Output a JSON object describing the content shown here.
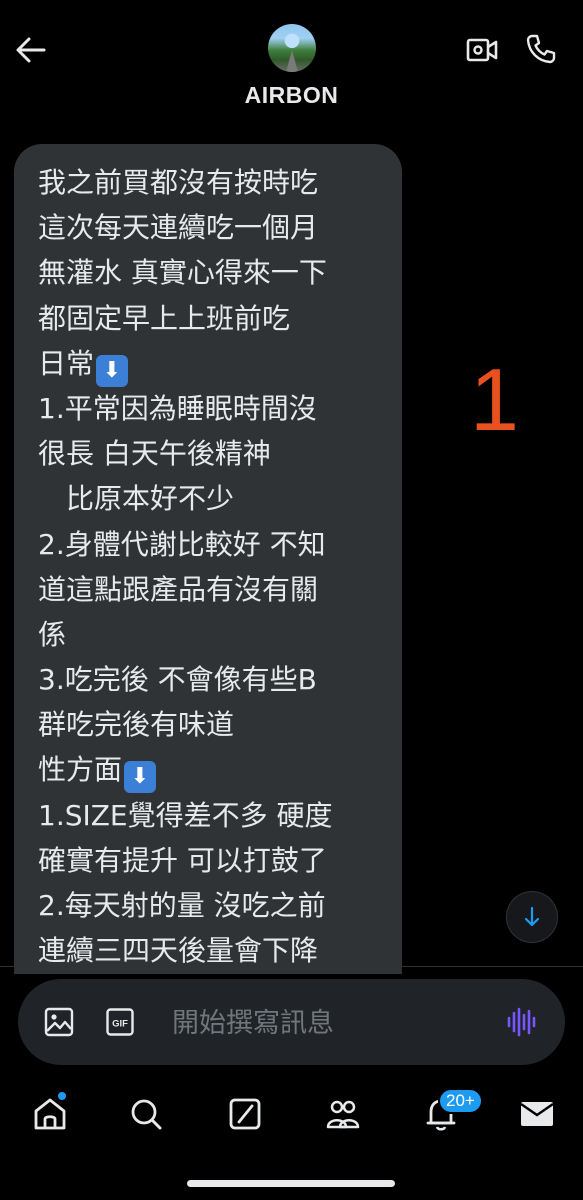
{
  "header": {
    "contact_name": "AIRBON",
    "back_icon": "arrow-left-icon",
    "video_icon": "video-camera-icon",
    "phone_icon": "phone-icon"
  },
  "message": {
    "lines": [
      "我之前買都沒有按時吃",
      "這次每天連續吃一個月",
      "無灌水 真實心得來一下",
      "都固定早上上班前吃",
      "日常",
      "1.平常因為睡眠時間沒",
      "很長 白天午後精神",
      "　比原本好不少",
      "2.身體代謝比較好 不知",
      "道這點跟產品有沒有關",
      "係",
      "3.吃完後 不會像有些B",
      "群吃完後有味道",
      "性方面",
      "1.SIZE覺得差不多 硬度",
      "確實有提升 可以打鼓了",
      "2.每天射的量 沒吃之前",
      "連續三四天後量會下降"
    ],
    "emoji": "⬇",
    "bubble_color": "#2f3336"
  },
  "annotation": {
    "number": "1",
    "color": "#e8501f"
  },
  "composer": {
    "placeholder": "開始撰寫訊息",
    "gif_label": "GIF",
    "image_icon": "image-icon",
    "voice_icon": "voice-waveform-icon"
  },
  "nav": {
    "items": [
      "home-icon",
      "search-icon",
      "grok-icon",
      "communities-icon",
      "notifications-icon",
      "messages-icon"
    ],
    "notification_badge": "20+",
    "accent": "#1d9bf0"
  }
}
